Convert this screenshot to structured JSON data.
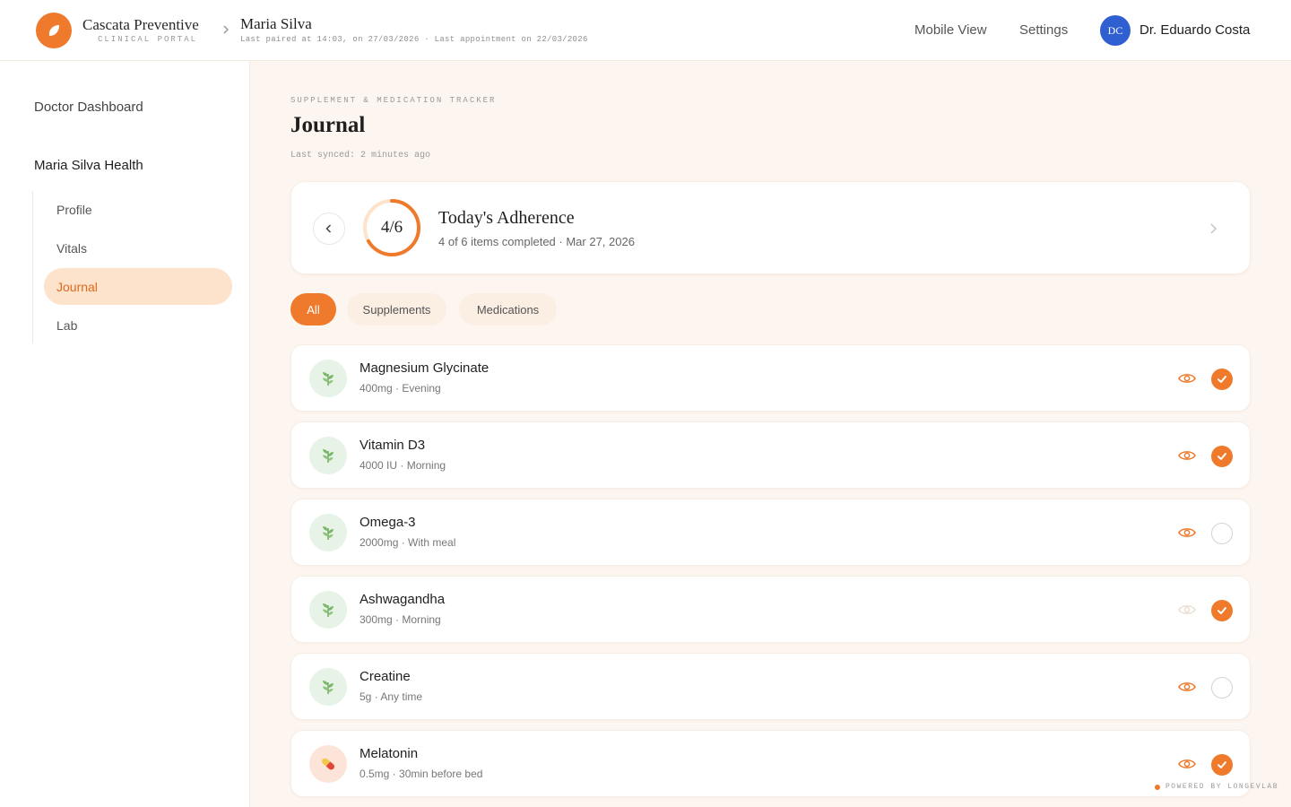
{
  "header": {
    "brand_name": "Cascata Preventive",
    "brand_sub": "CLINICAL PORTAL",
    "patient_name": "Maria Silva",
    "patient_meta": "Last paired at 14:03, on 27/03/2026 · Last appointment on 22/03/2026",
    "nav": [
      "Mobile View",
      "Settings"
    ],
    "avatar_initials": "DC",
    "doctor_name": "Dr. Eduardo Costa"
  },
  "sidebar": {
    "dashboard_label": "Doctor Dashboard",
    "section_title": "Maria Silva Health",
    "items": [
      {
        "label": "Profile",
        "active": false
      },
      {
        "label": "Vitals",
        "active": false
      },
      {
        "label": "Journal",
        "active": true
      },
      {
        "label": "Lab",
        "active": false
      }
    ]
  },
  "page": {
    "eyebrow": "SUPPLEMENT & MEDICATION TRACKER",
    "title": "Journal",
    "synced": "Last synced: 2 minutes ago"
  },
  "adherence": {
    "ring_label": "4/6",
    "completed": 4,
    "total": 6,
    "title": "Today's Adherence",
    "subtitle": "4 of 6 items completed · Mar 27, 2026"
  },
  "filters": [
    {
      "label": "All",
      "active": true
    },
    {
      "label": "Supplements",
      "active": false
    },
    {
      "label": "Medications",
      "active": false
    }
  ],
  "items": [
    {
      "name": "Magnesium Glycinate",
      "detail": "400mg · Evening",
      "type": "supplement",
      "icon": "leaf-icon",
      "done": true,
      "eye_faded": false
    },
    {
      "name": "Vitamin D3",
      "detail": "4000 IU · Morning",
      "type": "supplement",
      "icon": "leaf-icon",
      "done": true,
      "eye_faded": false
    },
    {
      "name": "Omega-3",
      "detail": "2000mg · With meal",
      "type": "supplement",
      "icon": "leaf-icon",
      "done": false,
      "eye_faded": false
    },
    {
      "name": "Ashwagandha",
      "detail": "300mg · Morning",
      "type": "supplement",
      "icon": "leaf-icon",
      "done": true,
      "eye_faded": true
    },
    {
      "name": "Creatine",
      "detail": "5g · Any time",
      "type": "supplement",
      "icon": "leaf-icon",
      "done": false,
      "eye_faded": false
    },
    {
      "name": "Melatonin",
      "detail": "0.5mg · 30min before bed",
      "type": "medication",
      "icon": "pill-icon",
      "done": true,
      "eye_faded": false
    }
  ],
  "footer": {
    "powered": "POWERED BY LONGEVLAB"
  },
  "colors": {
    "accent": "#f07a2c",
    "accent_soft": "#fde2cc",
    "avatar": "#2f5fd0"
  }
}
